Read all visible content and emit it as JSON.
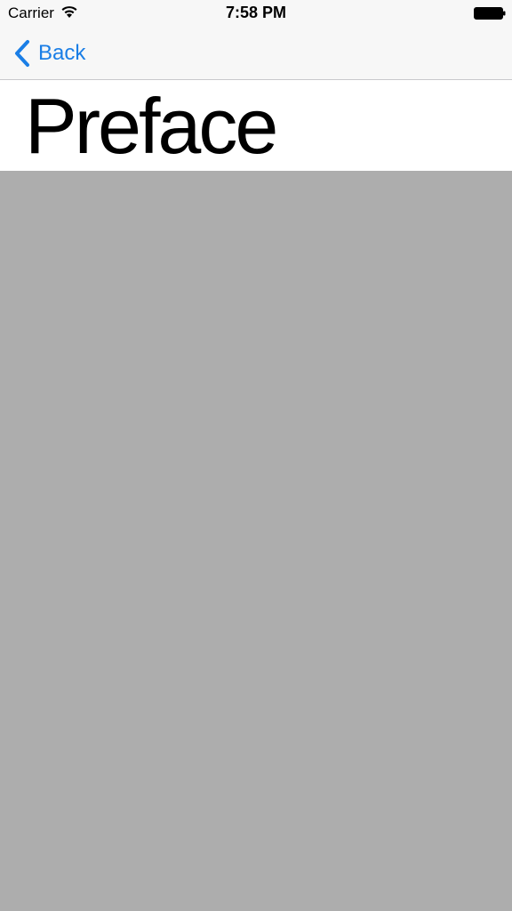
{
  "status_bar": {
    "carrier": "Carrier",
    "time": "7:58 PM",
    "wifi_icon": "wifi-icon",
    "battery_icon": "battery-icon"
  },
  "nav_bar": {
    "back_label": "Back",
    "back_icon": "chevron-left-icon"
  },
  "page": {
    "title": "Preface"
  },
  "colors": {
    "accent": "#1a7ee6",
    "bar_background": "#f7f7f7",
    "content_background": "#adadad"
  }
}
